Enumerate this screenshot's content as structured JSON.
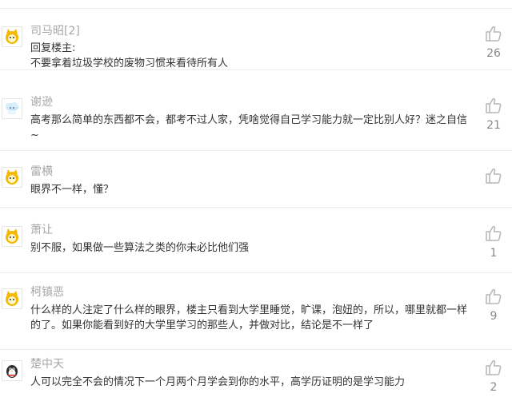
{
  "comments": [
    {
      "user": "司马昭[2]",
      "avatar_icon": "yellow-cat-avatar-icon",
      "lines": [
        "回复楼主:",
        "不要拿着垃圾学校的废物习惯来看待所有人"
      ],
      "likes": "26"
    },
    {
      "user": "谢逊",
      "avatar_icon": "blue-cloud-avatar-icon",
      "lines": [
        "高考那么简单的东西都不会，都考不过人家，凭啥觉得自己学习能力就一定比别人好？迷之自信",
        "~"
      ],
      "likes": "21"
    },
    {
      "user": "雷横",
      "avatar_icon": "yellow-cat-avatar-icon",
      "lines": [
        "眼界不一样，懂？"
      ],
      "likes": ""
    },
    {
      "user": "萧让",
      "avatar_icon": "yellow-cat-avatar-icon",
      "lines": [
        "别不服，如果做一些算法之类的你未必比他们强"
      ],
      "likes": "1"
    },
    {
      "user": "柯镇恶",
      "avatar_icon": "yellow-cat-avatar-icon",
      "lines": [
        "什么样的人注定了什么样的眼界，楼主只看到大学里睡觉，旷课，泡妞的，所以，哪里就都一样",
        "的了。如果你能看到好的大学里学习的那些人，并做对比，结论是不一样了"
      ],
      "likes": "9"
    },
    {
      "user": "楚中天",
      "avatar_icon": "penguin-avatar-icon",
      "lines": [
        "人可以完全不会的情况下一个月两个月学会到你的水平，高学历证明的是学习能力"
      ],
      "likes": "2"
    }
  ],
  "colors": {
    "username": "#a6a6a6",
    "text": "#333333",
    "like_icon": "#b5b5b5",
    "separator": "#ececec",
    "cat_avatar": "#f5b800"
  }
}
